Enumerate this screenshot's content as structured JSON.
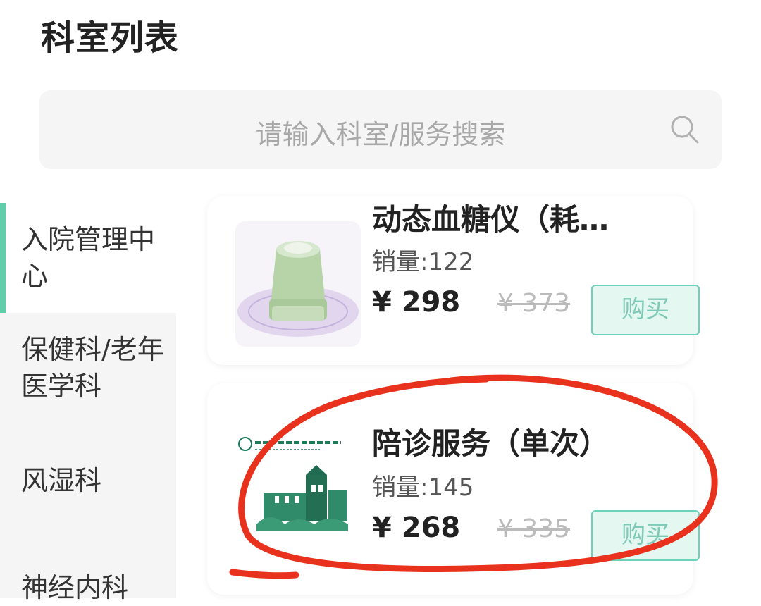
{
  "header": {
    "title": "科室列表"
  },
  "search": {
    "placeholder": "请输入科室/服务搜索",
    "icon": "search-icon"
  },
  "sidebar": {
    "items": [
      {
        "label": "入院管理中心",
        "active": true
      },
      {
        "label": "保健科/老年医学科",
        "active": false
      },
      {
        "label": "风湿科",
        "active": false
      },
      {
        "label": "神经内科",
        "active": false
      }
    ]
  },
  "products": [
    {
      "title": "动态血糖仪（耗…",
      "sales": "销量:122",
      "price": "¥ 298",
      "old_price": "¥ 373",
      "buy_label": "购买"
    },
    {
      "title": "陪诊服务（单次）",
      "sales": "销量:145",
      "price": "¥ 268",
      "old_price": "¥ 335",
      "buy_label": "购买"
    }
  ],
  "colors": {
    "accent": "#5fcfab",
    "buy_border": "#6fd1b8",
    "annotation": "#e8321e"
  }
}
